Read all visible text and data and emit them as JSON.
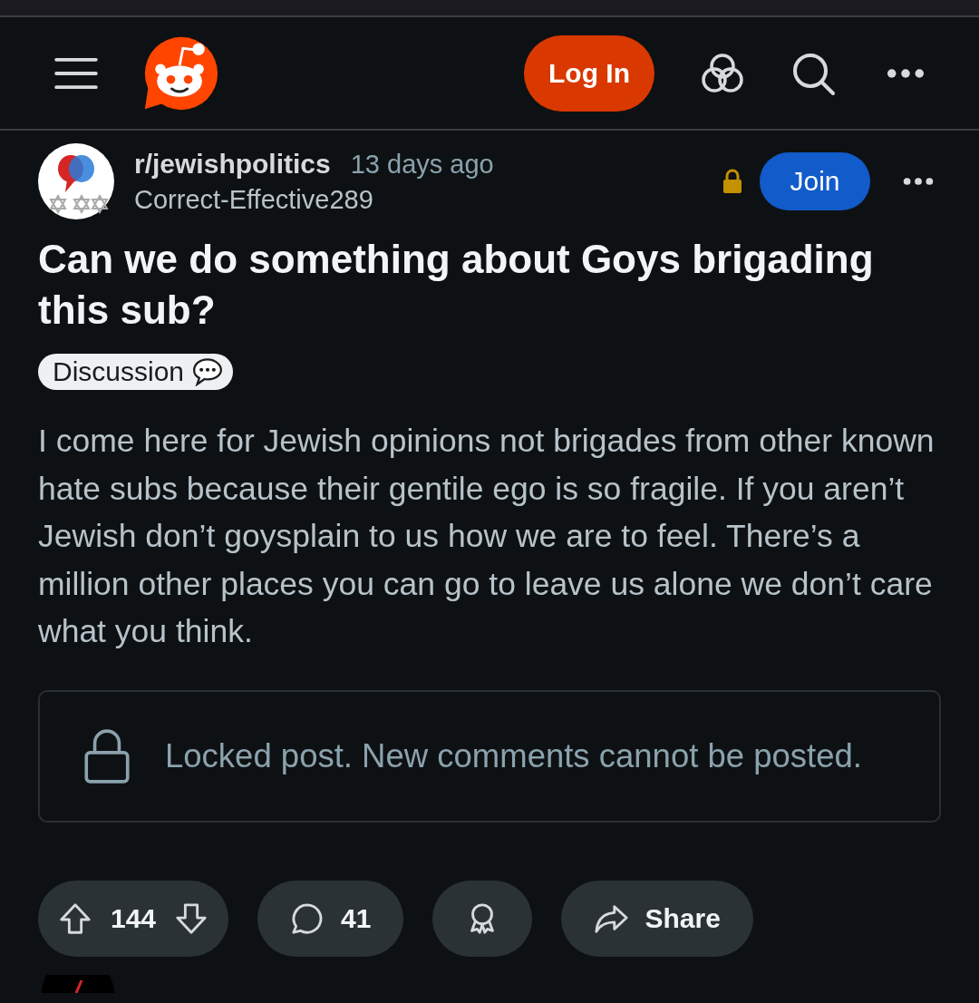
{
  "header": {
    "login": "Log In"
  },
  "post": {
    "subreddit": "r/jewishpolitics",
    "time": "13 days ago",
    "author": "Correct-Effective289",
    "locked": true,
    "join": "Join",
    "title": "Can we do something about Goys brigading this sub?",
    "flair": "Discussion",
    "body": "I come here for Jewish opinions not brigades from other known hate subs because their gentile ego is so fragile. If you aren’t Jewish don’t goysplain to us how we are to feel. There’s a million other places you can go to leave us alone we don’t care what you think.",
    "lock_notice": "Locked post. New comments cannot be posted.",
    "votes": "144",
    "comments": "41",
    "share": "Share"
  }
}
